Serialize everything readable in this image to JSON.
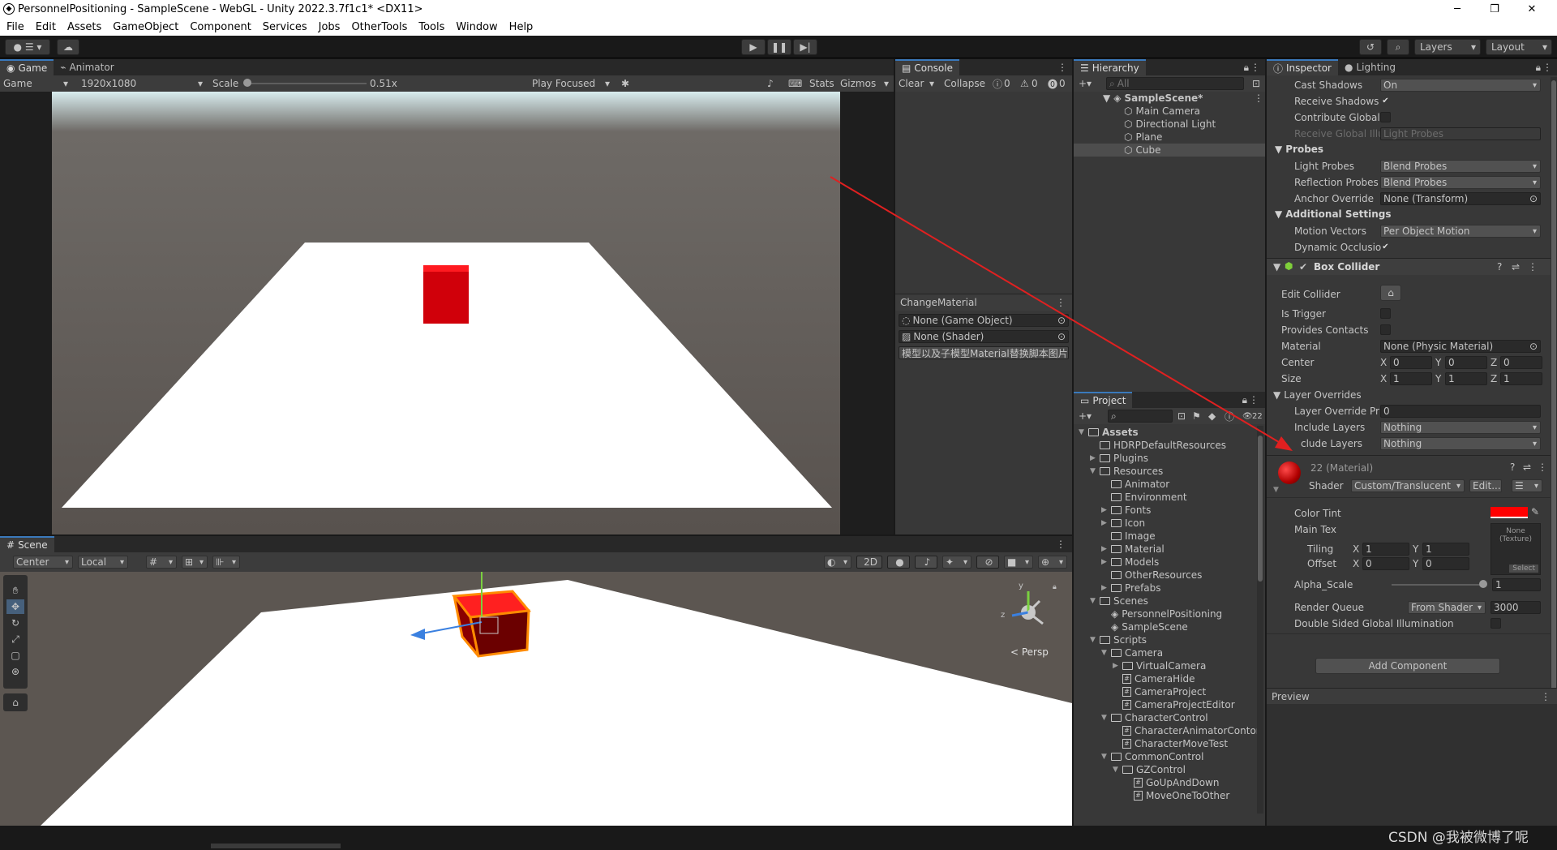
{
  "window": {
    "title": "PersonnelPositioning - SampleScene - WebGL - Unity 2022.3.7f1c1* <DX11>",
    "min": "─",
    "max": "❐",
    "close": "✕"
  },
  "menu": [
    "File",
    "Edit",
    "Assets",
    "GameObject",
    "Component",
    "Services",
    "Jobs",
    "OtherTools",
    "Tools",
    "Window",
    "Help"
  ],
  "toolbar": {
    "layers": "Layers",
    "layout": "Layout"
  },
  "game": {
    "tabs": [
      "Game",
      "Animator"
    ],
    "display": "Game",
    "resolution": "1920x1080",
    "scale_label": "Scale",
    "scale_value": "0.51x",
    "play_focused": "Play Focused",
    "stats": "Stats",
    "gizmos": "Gizmos"
  },
  "console": {
    "tab": "Console",
    "clear": "Clear",
    "collapse": "Collapse",
    "counts": [
      "0",
      "0",
      "0"
    ],
    "component_title": "ChangeMaterial",
    "fields": [
      "None (Game Object)",
      "None (Shader)"
    ],
    "note": "模型以及子模型Material替换脚本图片"
  },
  "hierarchy": {
    "tab": "Hierarchy",
    "search_placeholder": "All",
    "scene": "SampleScene*",
    "items": [
      "Main Camera",
      "Directional Light",
      "Plane",
      "Cube"
    ]
  },
  "project": {
    "tab": "Project",
    "badge": "22",
    "tree": [
      {
        "label": "Assets",
        "level": 0,
        "arrow": "▼",
        "kind": "folder"
      },
      {
        "label": "HDRPDefaultResources",
        "level": 1,
        "arrow": "",
        "kind": "folder"
      },
      {
        "label": "Plugins",
        "level": 1,
        "arrow": "▶",
        "kind": "folder"
      },
      {
        "label": "Resources",
        "level": 1,
        "arrow": "▼",
        "kind": "folder"
      },
      {
        "label": "Animator",
        "level": 2,
        "arrow": "",
        "kind": "folder"
      },
      {
        "label": "Environment",
        "level": 2,
        "arrow": "",
        "kind": "folder"
      },
      {
        "label": "Fonts",
        "level": 2,
        "arrow": "▶",
        "kind": "folder"
      },
      {
        "label": "Icon",
        "level": 2,
        "arrow": "▶",
        "kind": "folder"
      },
      {
        "label": "Image",
        "level": 2,
        "arrow": "",
        "kind": "folder"
      },
      {
        "label": "Material",
        "level": 2,
        "arrow": "▶",
        "kind": "folder"
      },
      {
        "label": "Models",
        "level": 2,
        "arrow": "▶",
        "kind": "folder"
      },
      {
        "label": "OtherResources",
        "level": 2,
        "arrow": "",
        "kind": "folder"
      },
      {
        "label": "Prefabs",
        "level": 2,
        "arrow": "▶",
        "kind": "folder"
      },
      {
        "label": "Scenes",
        "level": 1,
        "arrow": "▼",
        "kind": "folder"
      },
      {
        "label": "PersonnelPositioning",
        "level": 2,
        "arrow": "",
        "kind": "scene"
      },
      {
        "label": "SampleScene",
        "level": 2,
        "arrow": "",
        "kind": "scene"
      },
      {
        "label": "Scripts",
        "level": 1,
        "arrow": "▼",
        "kind": "folder"
      },
      {
        "label": "Camera",
        "level": 2,
        "arrow": "▼",
        "kind": "folder"
      },
      {
        "label": "VirtualCamera",
        "level": 3,
        "arrow": "▶",
        "kind": "folder"
      },
      {
        "label": "CameraHide",
        "level": 3,
        "arrow": "",
        "kind": "script"
      },
      {
        "label": "CameraProject",
        "level": 3,
        "arrow": "",
        "kind": "script"
      },
      {
        "label": "CameraProjectEditor",
        "level": 3,
        "arrow": "",
        "kind": "script"
      },
      {
        "label": "CharacterControl",
        "level": 2,
        "arrow": "▼",
        "kind": "folder"
      },
      {
        "label": "CharacterAnimatorContor",
        "level": 3,
        "arrow": "",
        "kind": "script"
      },
      {
        "label": "CharacterMoveTest",
        "level": 3,
        "arrow": "",
        "kind": "script"
      },
      {
        "label": "CommonControl",
        "level": 2,
        "arrow": "▼",
        "kind": "folder"
      },
      {
        "label": "GZControl",
        "level": 3,
        "arrow": "▼",
        "kind": "folder"
      },
      {
        "label": "GoUpAndDown",
        "level": 4,
        "arrow": "",
        "kind": "script"
      },
      {
        "label": "MoveOneToOther",
        "level": 4,
        "arrow": "",
        "kind": "script"
      }
    ]
  },
  "inspector": {
    "tabs": [
      "Inspector",
      "Lighting"
    ],
    "cast_shadows": {
      "label": "Cast Shadows",
      "value": "On"
    },
    "receive_shadows": "Receive Shadows",
    "contribute_gi": "Contribute Global I",
    "receive_gi": {
      "label": "Receive Global Illu",
      "value": "Light Probes"
    },
    "probes_header": "Probes",
    "light_probes": {
      "label": "Light Probes",
      "value": "Blend Probes"
    },
    "reflection_probes": {
      "label": "Reflection Probes",
      "value": "Blend Probes"
    },
    "anchor_override": {
      "label": "Anchor Override",
      "value": "None (Transform)"
    },
    "additional_header": "Additional Settings",
    "motion_vectors": {
      "label": "Motion Vectors",
      "value": "Per Object Motion"
    },
    "dynamic_occlusion": "Dynamic Occlusio",
    "box_collider": {
      "title": "Box Collider",
      "edit_collider": "Edit Collider",
      "is_trigger": "Is Trigger",
      "provides_contacts": "Provides Contacts",
      "material": {
        "label": "Material",
        "value": "None (Physic Material)"
      },
      "center": {
        "label": "Center",
        "x": "0",
        "y": "0",
        "z": "0"
      },
      "size": {
        "label": "Size",
        "x": "1",
        "y": "1",
        "z": "1"
      },
      "layer_overrides": "Layer Overrides",
      "layer_override_priority": {
        "label": "Layer Override Pric",
        "value": "0"
      },
      "include_layers": {
        "label": "Include Layers",
        "value": "Nothing"
      },
      "exclude_layers": {
        "label": "clude Layers",
        "value": "Nothing"
      }
    },
    "material": {
      "title": "22 (Material)",
      "shader_label": "Shader",
      "shader": "Custom/Translucent",
      "edit": "Edit...",
      "color_tint": "Color Tint",
      "color": "#ff0000",
      "main_tex": "Main Tex",
      "tex_none": "None",
      "tex_type": "(Texture)",
      "tiling": {
        "label": "Tiling",
        "x": "1",
        "y": "1"
      },
      "offset": {
        "label": "Offset",
        "x": "0",
        "y": "0"
      },
      "select": "Select",
      "alpha_scale": {
        "label": "Alpha_Scale",
        "value": "1"
      },
      "render_queue": {
        "label": "Render Queue",
        "mode": "From Shader",
        "value": "3000"
      },
      "double_sided": "Double Sided Global Illumination"
    },
    "add_component": "Add Component",
    "preview": "Preview"
  },
  "scene": {
    "tab": "Scene",
    "pivot": "Center",
    "space": "Local",
    "mode_2d": "2D",
    "persp": "< Persp",
    "axis_y": "y",
    "axis_z": "z"
  },
  "watermark": "CSDN @我被微博了呢",
  "colors": {
    "accent": "#3a79bb",
    "red": "#e00000",
    "arrow": "#e02020"
  }
}
